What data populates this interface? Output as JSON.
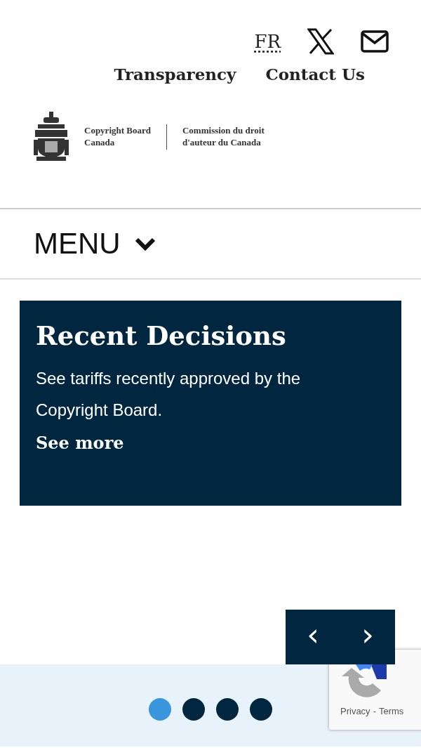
{
  "header": {
    "language_link": "FR",
    "links": [
      "Transparency",
      "Contact Us"
    ],
    "logo": {
      "name_en": [
        "Copyright Board",
        "Canada"
      ],
      "name_fr": [
        "Commission du droit",
        "d'auteur du Canada"
      ]
    }
  },
  "menu": {
    "label": "MENU",
    "expanded": false
  },
  "carousel": {
    "slide": {
      "title": "Recent Decisions",
      "text": "See tariffs recently approved by the Copyright Board.",
      "link": "See more"
    },
    "prev": "‹",
    "next": "›",
    "dots": [
      {
        "selected": true
      },
      {
        "selected": false
      },
      {
        "selected": false
      },
      {
        "selected": false
      }
    ]
  },
  "recaptcha": {
    "privacy": "Privacy",
    "separator": "-",
    "terms": "Terms"
  }
}
